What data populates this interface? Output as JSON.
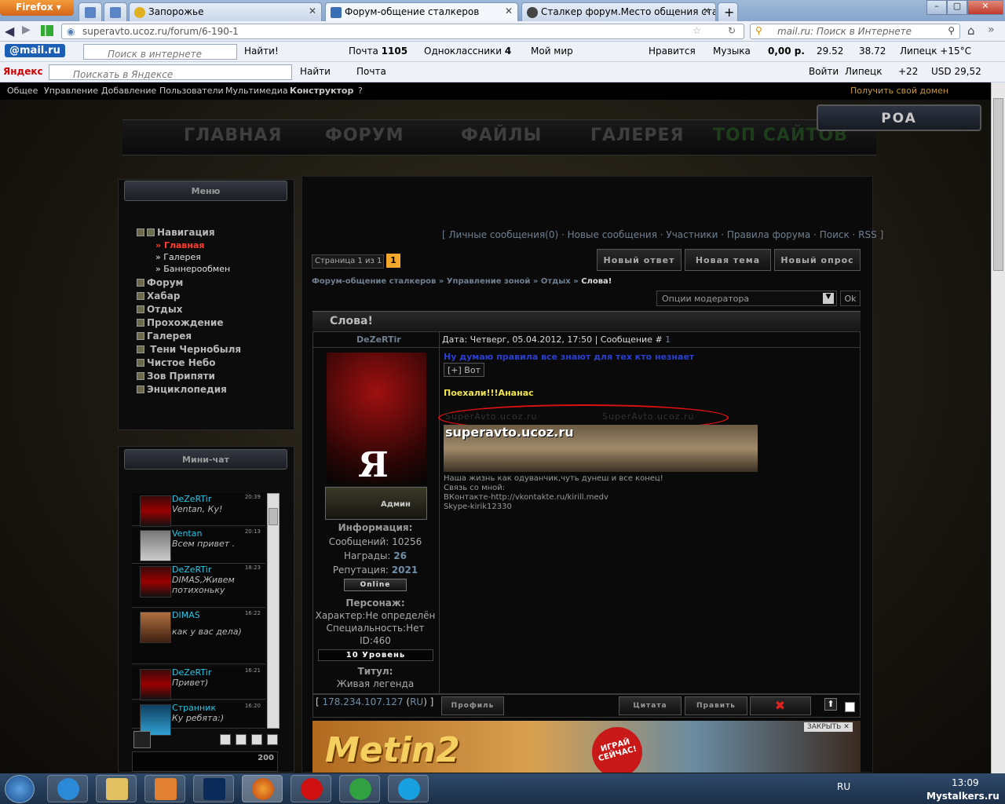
{
  "browser": {
    "firefox_label": "Firefox",
    "tabs": [
      {
        "title": "Запорожье"
      },
      {
        "title": "Форум-общение сталкеров"
      },
      {
        "title": "Сталкер форум.Место общения ста..."
      }
    ],
    "url": "superavto.ucoz.ru/forum/6-190-1",
    "search_placeholder": "mail.ru: Поиск в Интернете"
  },
  "mailru_bar": {
    "logo": "@mail.ru",
    "search_placeholder": "Поиск в интернете",
    "find_label": "Найти!",
    "mail_label": "Почта",
    "mail_count": "1105",
    "ok_label": "Одноклассники",
    "ok_count": "4",
    "mymir_label": "Мой мир",
    "like_label": "Нравится",
    "music_label": "Музыка",
    "balance": "0,00 р.",
    "usd": "29.52",
    "eur": "38.72",
    "weather": "Липецк +15°C"
  },
  "yandex_bar": {
    "logo": "Яндекс",
    "search_placeholder": "Поискать в Яндексе",
    "find_label": "Найти",
    "mail_label": "Почта",
    "login_label": "Войти",
    "city": "Липецк",
    "temp": "+22",
    "usd": "USD 29,52"
  },
  "ucoz_bar": {
    "items": [
      "Общее",
      "Управление",
      "Добавление",
      "Пользователи",
      "Мультимедиа",
      "Конструктор",
      "?"
    ],
    "get_domain": "Получить свой домен"
  },
  "site": {
    "sign": "POA",
    "menu": [
      "ГЛАВНАЯ",
      "ФОРУМ",
      "ФАЙЛЫ",
      "ГАЛЕРЕЯ",
      "ТОП САЙТОВ"
    ],
    "menu_block_title": "Меню",
    "nav": {
      "main": "Навигация",
      "sub": [
        "Главная",
        "Галерея",
        "Баннерообмен"
      ],
      "items": [
        "Форум",
        "Хабар",
        "Отдых",
        "Прохождение",
        "Галерея",
        "Тени Чернобыля",
        "Чистое Небо",
        "Зов Припяти",
        "Энциклопедия"
      ]
    },
    "chat_block_title": "Мини-чат",
    "chat": [
      {
        "name": "DeZeRTir",
        "time": "20:39",
        "text": "Ventan, Ку!"
      },
      {
        "name": "Ventan",
        "time": "20:13",
        "text": "Всем привет ."
      },
      {
        "name": "DeZeRTir",
        "time": "18:23",
        "text": "DIMAS,Живем потихоньку"
      },
      {
        "name": "DIMAS",
        "time": "16:22",
        "text": "как у вас дела)"
      },
      {
        "name": "DeZeRTir",
        "time": "16:21",
        "text": "Привет)"
      },
      {
        "name": "Странник",
        "time": "16:20",
        "text": "Ку ребята:)"
      }
    ],
    "chat_limit": "200"
  },
  "forum": {
    "toplinks": "[ Личные сообщения(0) · Новые сообщения · Участники · Правила форума · Поиск · RSS ]",
    "page_label": "Страница 1 из 1",
    "page_num": "1",
    "buttons": [
      "Новый ответ",
      "Новая тема",
      "Новый опрос"
    ],
    "breadcrumb": [
      "Форум-общение сталкеров",
      "Управление зоной",
      "Отдых",
      "Слова!"
    ],
    "moderator_options": "Опции модератора",
    "ok": "Ok",
    "thread_title": "Слова!",
    "author": "DeZeRTir",
    "post_header": "Дата: Четверг, 05.04.2012, 17:50 | Сообщение #",
    "post_num": "1",
    "post_line1": "Ну думаю правила все знают для тех кто незнает",
    "spoiler": "[+] Вот",
    "post_line2": "Поехали!!!Ананас",
    "watermark1": "SuperAvto.ucoz.ru",
    "watermark2": "SuperAvto.ucoz.ru",
    "banner_text": "superavto.ucoz.ru",
    "signature": [
      "Наша жизнь как одуванчик,чуть дунеш и все конец!",
      "Связь со мной:",
      "ВКонтакте-http://vkontakte.ru/kirill.medv",
      "Skype-kirik12330"
    ],
    "avatar_letter": "Я",
    "rank_label": "Админ",
    "info_title": "Информация:",
    "messages": "Сообщений: 10256",
    "awards_label": "Награды:",
    "awards": "26",
    "rep_label": "Репутация:",
    "rep": "2021",
    "online": "Online",
    "persona_title": "Персонаж:",
    "character": "Характер:Не определён",
    "specialty": "Специальность:Нет",
    "id": "ID:460",
    "level": "10 Уровень",
    "title_label": "Титул:",
    "title_value": "Живая легенда",
    "ip": "178.234.107.127",
    "ip_cc": "RU",
    "bottom_buttons": [
      "Профиль",
      "Цитата",
      "Править"
    ],
    "ad_close": "ЗАКРЫТЬ",
    "ad_cta": "ИГРАЙ СЕЙЧАС!",
    "ad_title": "Metin2"
  },
  "taskbar": {
    "lang": "RU",
    "time": "13:09",
    "watermark": "Mystalkers.ru"
  }
}
